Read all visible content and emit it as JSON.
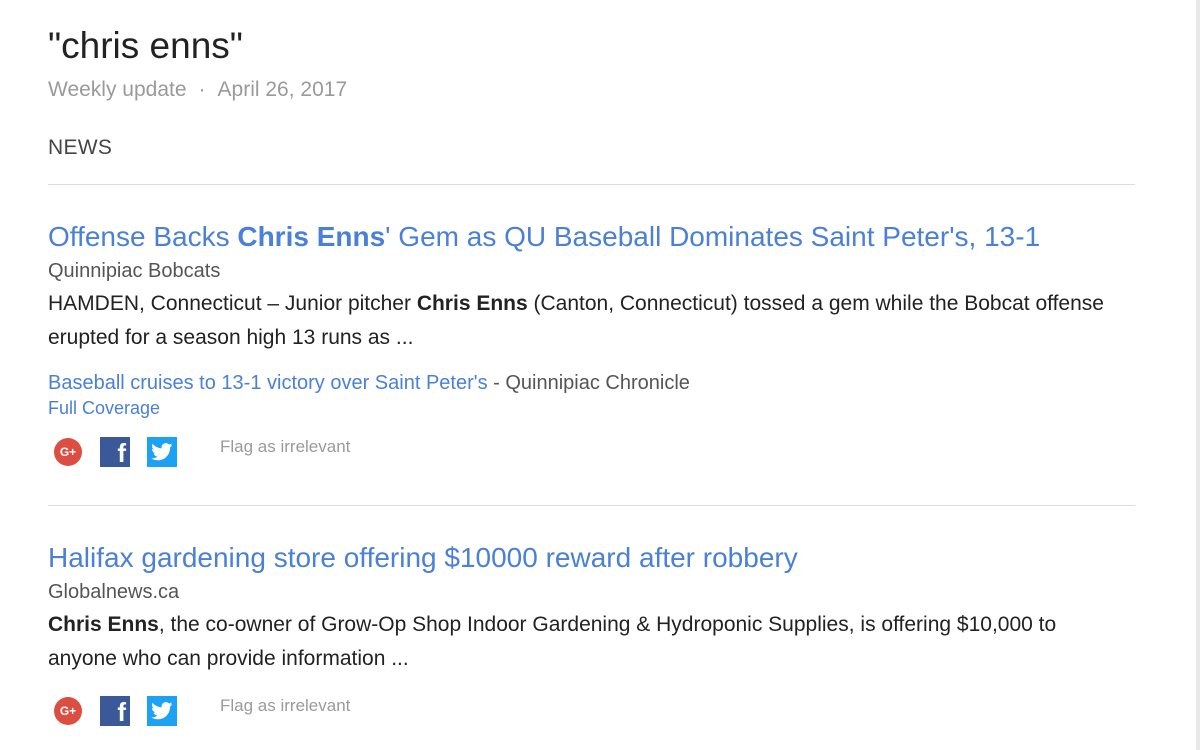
{
  "alert": {
    "title": "\"chris enns\"",
    "frequency": "Weekly update",
    "separator": "·",
    "date": "April 26, 2017"
  },
  "section": {
    "label": "NEWS"
  },
  "items": [
    {
      "headline_pre": "Offense Backs ",
      "headline_bold": "Chris Enns",
      "headline_post": "' Gem as QU Baseball Dominates Saint Peter's, 13-1",
      "source": "Quinnipiac Bobcats",
      "snippet_pre": "HAMDEN, Connecticut – Junior pitcher ",
      "snippet_bold": "Chris Enns",
      "snippet_post": " (Canton, Connecticut) tossed a gem while the Bobcat offense erupted for a season high 13 runs as ...",
      "related_link": "Baseball cruises to 13-1 victory over Saint Peter's",
      "related_dash": " - ",
      "related_source": "Quinnipiac Chronicle",
      "coverage": "Full Coverage",
      "share": {
        "gplus": "G+",
        "facebook": "f",
        "flag": "Flag as irrelevant"
      }
    },
    {
      "headline_pre": "Halifax gardening store offering $10000 reward after robbery",
      "headline_bold": "",
      "headline_post": "",
      "source": "Globalnews.ca",
      "snippet_pre": "",
      "snippet_bold": "Chris Enns",
      "snippet_post": ", the co-owner of Grow-Op Shop Indoor Gardening & Hydroponic Supplies, is offering $10,000 to anyone who can provide information ...",
      "share": {
        "gplus": "G+",
        "facebook": "f",
        "flag": "Flag as irrelevant"
      }
    }
  ],
  "colors": {
    "link": "#4a80d6",
    "muted": "#9a9a9a",
    "gplus": "#dc4e41",
    "facebook": "#3b5998",
    "twitter": "#1da1f2"
  },
  "icons": {
    "gplus": "google-plus-icon",
    "facebook": "facebook-icon",
    "twitter": "twitter-icon"
  }
}
